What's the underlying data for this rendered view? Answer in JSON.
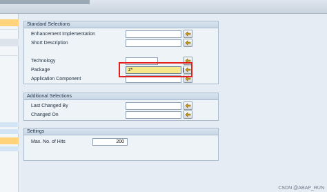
{
  "sections": {
    "standard": {
      "title": "Standard Selections",
      "fields": {
        "enhancement_implementation": {
          "label": "Enhancement Implementation",
          "value": ""
        },
        "short_description": {
          "label": "Short Description",
          "value": ""
        },
        "technology": {
          "label": "Technology",
          "value": ""
        },
        "package": {
          "label": "Package",
          "value": "z*"
        },
        "application_component": {
          "label": "Application Component",
          "value": ""
        }
      }
    },
    "additional": {
      "title": "Additional Selections",
      "fields": {
        "last_changed_by": {
          "label": "Last Changed By",
          "value": ""
        },
        "changed_on": {
          "label": "Changed On",
          "value": ""
        }
      }
    },
    "settings": {
      "title": "Settings",
      "fields": {
        "max_hits": {
          "label": "Max. No. of Hits",
          "value": "200"
        }
      }
    }
  },
  "icons": {
    "value_help": "value-help-icon",
    "multiple_selection": "multiple-selection-icon"
  },
  "colors": {
    "active_field": "#f7e88a",
    "highlight_frame": "#e0201b",
    "group_border": "#a8b9cb"
  },
  "watermark": "CSDN @ABAP_RUN"
}
